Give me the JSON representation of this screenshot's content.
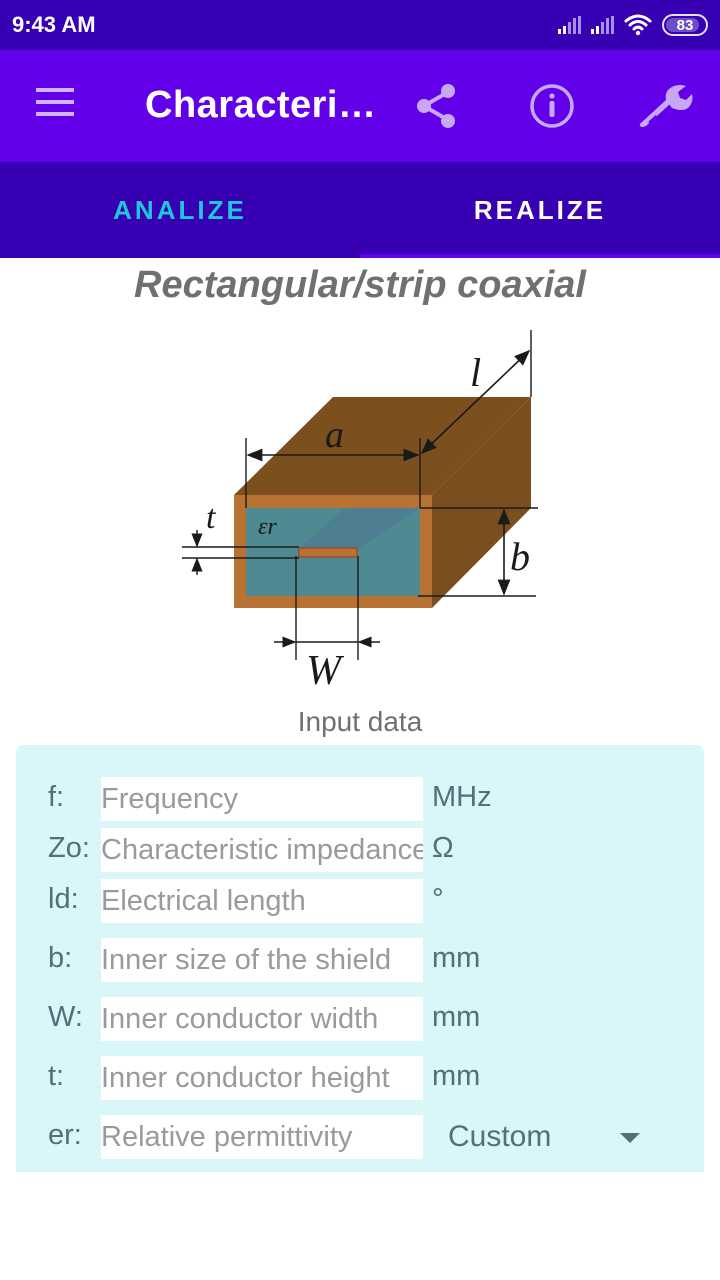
{
  "status_bar": {
    "time": "9:43 AM",
    "battery": "83",
    "icons": [
      "signal-icon",
      "signal-icon",
      "wifi-icon",
      "battery-icon"
    ]
  },
  "app_bar": {
    "title": "Characteri…",
    "actions": [
      "share-icon",
      "info-icon",
      "wrench-icon"
    ],
    "menu_icon": "hamburger-menu-icon"
  },
  "tabs": [
    {
      "label": "ANALIZE",
      "selected": false
    },
    {
      "label": "REALIZE",
      "selected": true
    }
  ],
  "section_title": "Rectangular/strip coaxial",
  "diagram": {
    "labels": {
      "a": "a",
      "b": "b",
      "l": "l",
      "t": "t",
      "W": "W",
      "er": "εr"
    }
  },
  "input_data_label": "Input data",
  "inputs": [
    {
      "label": "f:",
      "placeholder": "Frequency",
      "value": "",
      "unit": "MHz"
    },
    {
      "label": "Zo:",
      "placeholder": "Characteristic impedance",
      "value": "",
      "unit": "Ω"
    },
    {
      "label": "ld:",
      "placeholder": "Electrical length",
      "value": "",
      "unit": "°"
    },
    {
      "label": "b:",
      "placeholder": "Inner size of the shield",
      "value": "",
      "unit": "mm"
    },
    {
      "label": "W:",
      "placeholder": "Inner conductor width",
      "value": "",
      "unit": "mm"
    },
    {
      "label": "t:",
      "placeholder": "Inner conductor height",
      "value": "",
      "unit": "mm"
    },
    {
      "label": "er:",
      "placeholder": "Relative permittivity",
      "value": "",
      "unit_select": "Custom"
    }
  ],
  "colors": {
    "status_bar": "#3700b3",
    "app_bar": "#6200ea",
    "tab_bar": "#3700b3",
    "tab_active_text": "#1ec8d8",
    "card_bg": "#d9f6f8"
  }
}
